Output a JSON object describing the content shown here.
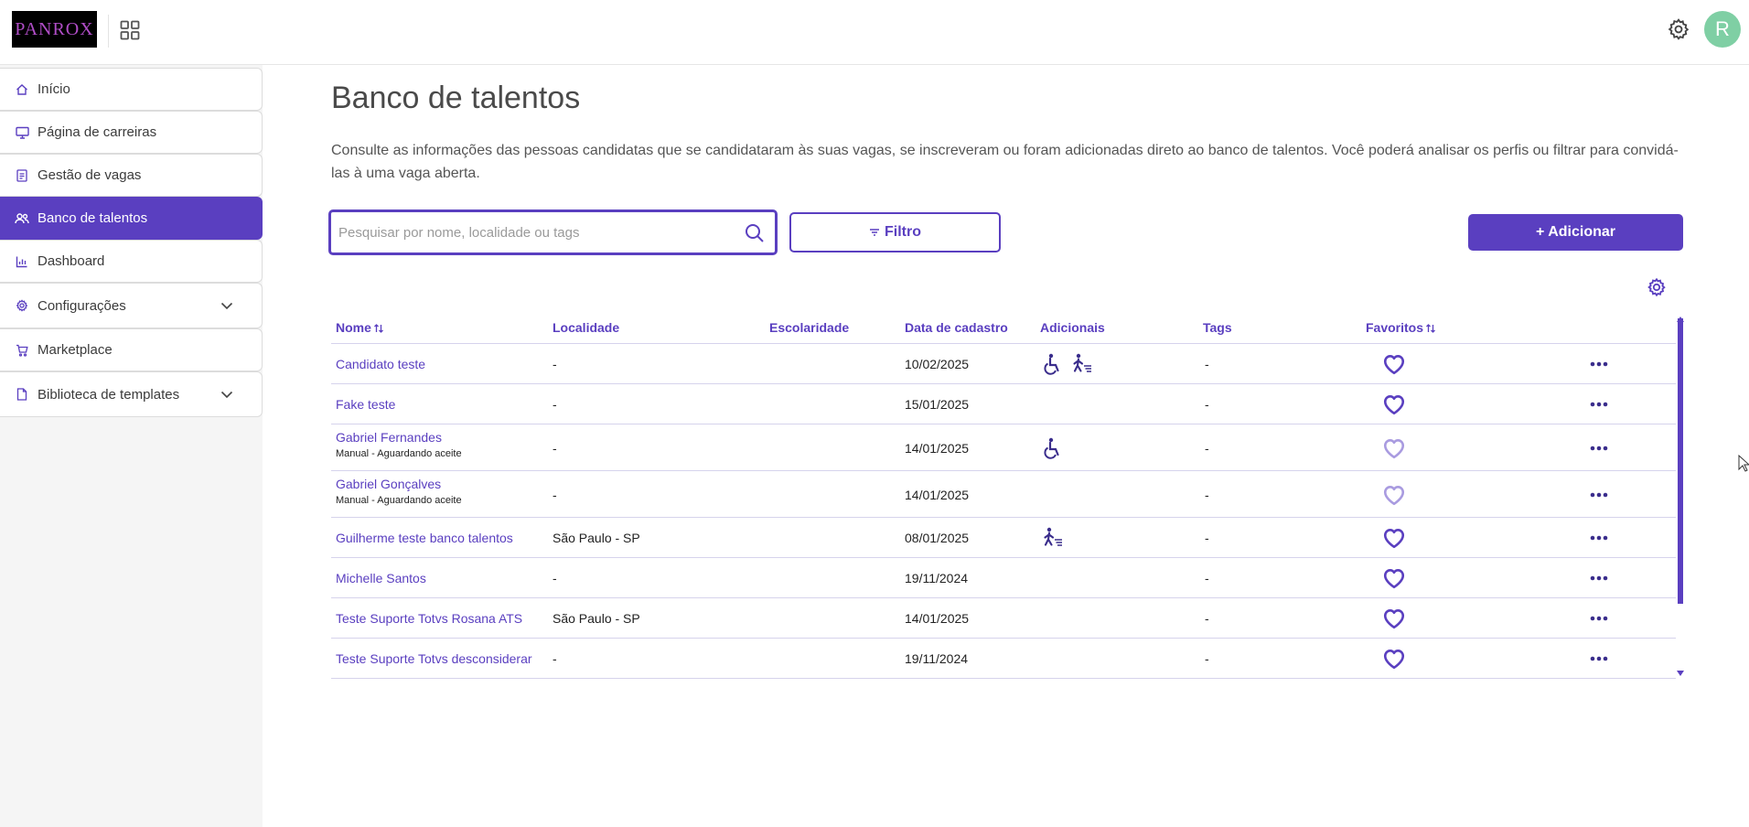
{
  "app": {
    "logo_text": "PANROX",
    "avatar_initial": "R",
    "colors": {
      "accent": "#5a3fc0",
      "avatar": "#7fcfa4",
      "heart_muted": "#a99be0"
    }
  },
  "sidebar": {
    "items": [
      {
        "label": "Início",
        "icon": "home-icon"
      },
      {
        "label": "Página de carreiras",
        "icon": "monitor-icon"
      },
      {
        "label": "Gestão de vagas",
        "icon": "document-icon"
      },
      {
        "label": "Banco de talentos",
        "icon": "people-icon",
        "active": true
      },
      {
        "label": "Dashboard",
        "icon": "chart-icon"
      },
      {
        "label": "Configurações",
        "icon": "gear-icon",
        "expandable": true
      },
      {
        "label": "Marketplace",
        "icon": "cart-icon"
      },
      {
        "label": "Biblioteca de templates",
        "icon": "file-icon",
        "expandable": true
      }
    ]
  },
  "main": {
    "title": "Banco de talentos",
    "description": "Consulte as informações das pessoas candidatas que se candidataram às suas vagas, se inscreveram ou foram adicionadas direto ao banco de talentos. Você poderá analisar os perfis ou filtrar para convidá-las à uma vaga aberta.",
    "search": {
      "placeholder": "Pesquisar por nome, localidade ou tags",
      "value": ""
    },
    "filter_label": "Filtro",
    "add_label": "+ Adicionar"
  },
  "table": {
    "columns": {
      "nome": "Nome",
      "localidade": "Localidade",
      "escolaridade": "Escolaridade",
      "data": "Data de cadastro",
      "adicionais": "Adicionais",
      "tags": "Tags",
      "favoritos": "Favoritos"
    },
    "rows": [
      {
        "name": "Candidato teste",
        "sub": "",
        "location": "-",
        "education": "",
        "date": "10/02/2025",
        "extras": [
          "wheelchair-icon",
          "walking-cane-icon"
        ],
        "tags": "-",
        "favorite": true
      },
      {
        "name": "Fake teste",
        "sub": "",
        "location": "-",
        "education": "",
        "date": "15/01/2025",
        "extras": [],
        "tags": "-",
        "favorite": true
      },
      {
        "name": "Gabriel Fernandes",
        "sub": "Manual - Aguardando aceite",
        "location": "-",
        "education": "",
        "date": "14/01/2025",
        "extras": [
          "wheelchair-icon"
        ],
        "tags": "-",
        "favorite": false
      },
      {
        "name": "Gabriel Gonçalves",
        "sub": "Manual - Aguardando aceite",
        "location": "-",
        "education": "",
        "date": "14/01/2025",
        "extras": [],
        "tags": "-",
        "favorite": false
      },
      {
        "name": "Guilherme teste banco talentos",
        "sub": "",
        "location": "São Paulo - SP",
        "education": "",
        "date": "08/01/2025",
        "extras": [
          "walking-cane-icon"
        ],
        "tags": "-",
        "favorite": true
      },
      {
        "name": "Michelle Santos",
        "sub": "",
        "location": "-",
        "education": "",
        "date": "19/11/2024",
        "extras": [],
        "tags": "-",
        "favorite": true
      },
      {
        "name": "Teste Suporte Totvs Rosana ATS",
        "sub": "",
        "location": "São Paulo - SP",
        "education": "",
        "date": "14/01/2025",
        "extras": [],
        "tags": "-",
        "favorite": true
      },
      {
        "name": "Teste Suporte Totvs desconsiderar",
        "sub": "",
        "location": "-",
        "education": "",
        "date": "19/11/2024",
        "extras": [],
        "tags": "-",
        "favorite": true
      }
    ]
  }
}
